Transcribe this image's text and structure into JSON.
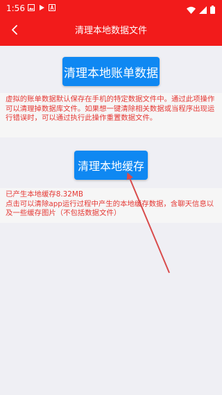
{
  "status_bar": {
    "time": "1:56",
    "icons": [
      "image-icon",
      "play-store-icon",
      "font-a-icon",
      "wifi-icon",
      "signal-icon",
      "battery-icon"
    ]
  },
  "app_bar": {
    "title": "清理本地数据文件",
    "back_icon": "chevron-left-icon"
  },
  "bill_section": {
    "button_label": "清理本地账单数据",
    "description": "虚拟的账单数据默认保存在手机的特定数据文件中。通过此项操作可以清理掉数据库文件。如果想一键清除相关数据或当程序出现运行错误时，可以通过执行此操作重置数据文件。"
  },
  "cache_section": {
    "button_label": "清理本地缓存",
    "cache_size": "已产生本地缓存8.32MB",
    "description": "点击可以清除app运行过程中产生的本地缓存数据，含聊天信息以及一些缓存图片（不包括数据文件）"
  },
  "colors": {
    "header": "#f21b1b",
    "button": "#0f88f2",
    "description_text": "#e53935",
    "page_background": "#efeff4",
    "annotation_arrow": "#d94b4b"
  }
}
